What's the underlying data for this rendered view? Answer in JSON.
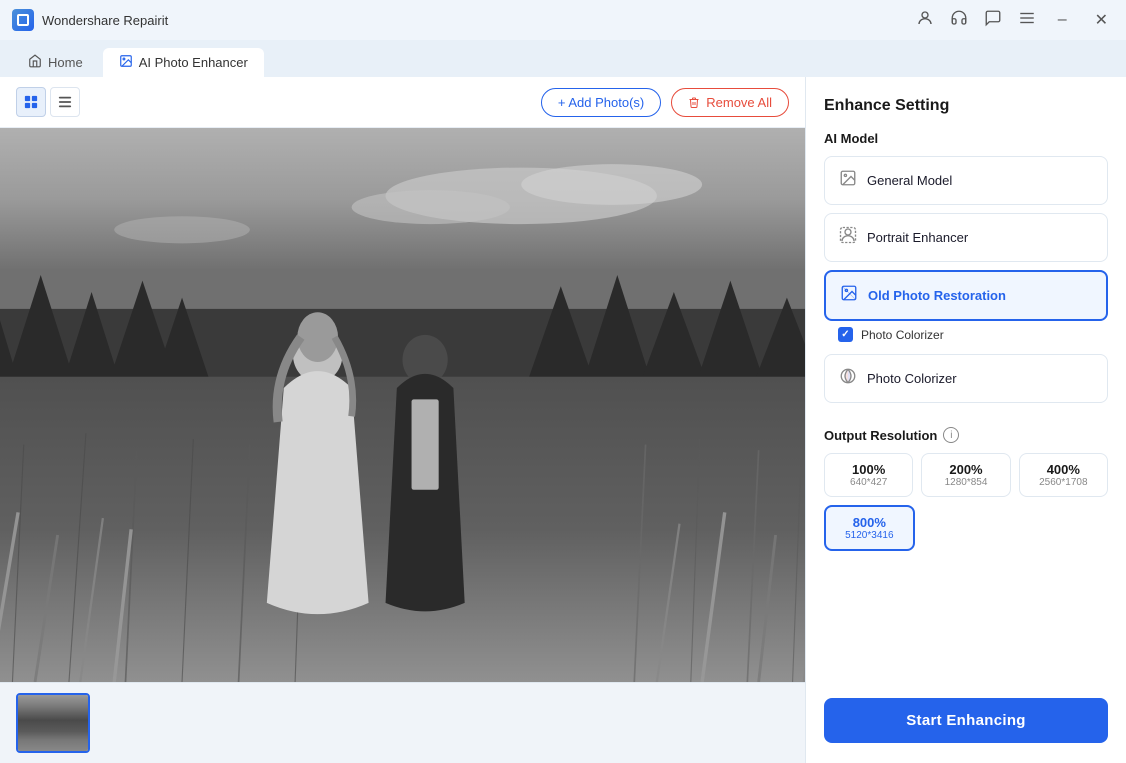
{
  "app": {
    "title": "Wondershare Repairit",
    "icon_alt": "app-icon"
  },
  "titlebar": {
    "profile_icon": "👤",
    "headset_icon": "🎧",
    "chat_icon": "💬",
    "menu_icon": "☰",
    "minimize_label": "–",
    "close_label": "✕"
  },
  "nav": {
    "home_label": "Home",
    "enhancer_label": "AI Photo Enhancer"
  },
  "toolbar": {
    "add_label": "+ Add Photo(s)",
    "remove_label": "Remove All",
    "grid_icon": "⊞",
    "list_icon": "≡"
  },
  "settings_panel": {
    "title": "Enhance Setting",
    "ai_model_label": "AI Model",
    "models": [
      {
        "id": "general",
        "label": "General Model",
        "selected": false
      },
      {
        "id": "portrait",
        "label": "Portrait Enhancer",
        "selected": false
      },
      {
        "id": "old-photo",
        "label": "Old Photo Restoration",
        "selected": true
      },
      {
        "id": "colorizer",
        "label": "Photo Colorizer",
        "selected": false
      }
    ],
    "sub_option_label": "Photo Colorizer",
    "output_resolution_label": "Output Resolution",
    "resolutions": [
      {
        "pct": "100%",
        "dim": "640*427",
        "selected": false
      },
      {
        "pct": "200%",
        "dim": "1280*854",
        "selected": false
      },
      {
        "pct": "400%",
        "dim": "2560*1708",
        "selected": false
      },
      {
        "pct": "800%",
        "dim": "5120*3416",
        "selected": true
      }
    ],
    "start_btn_label": "Start Enhancing"
  }
}
